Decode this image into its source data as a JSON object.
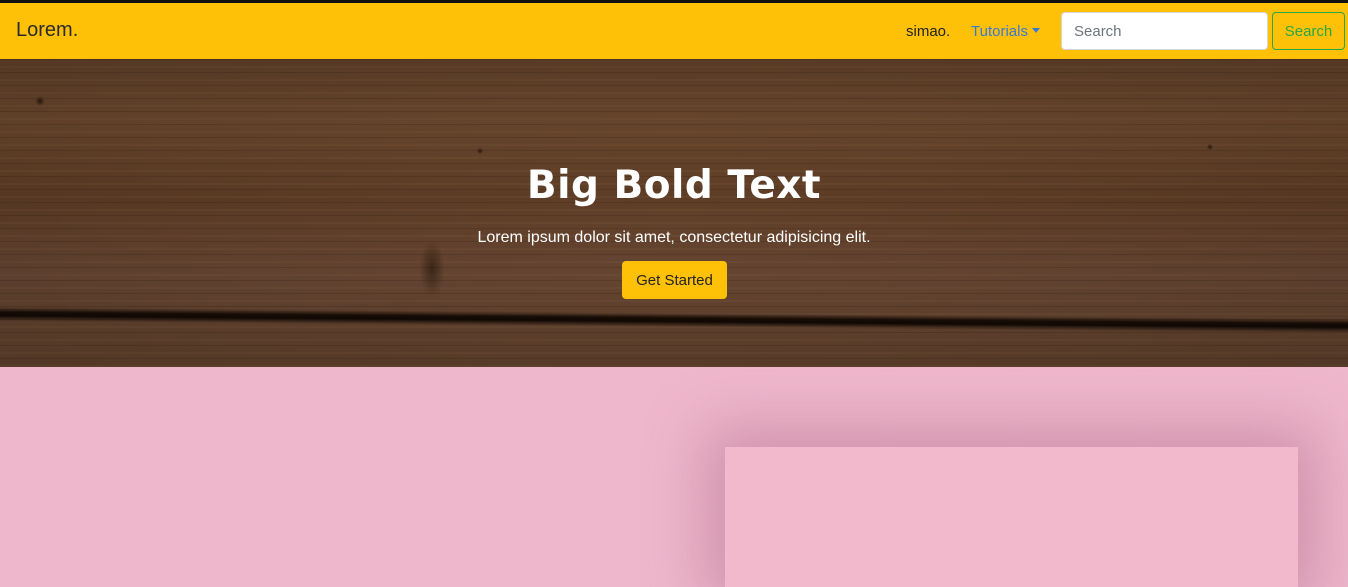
{
  "navbar": {
    "brand": "Lorem.",
    "link_simao": "simao.",
    "dropdown_label": "Tutorials",
    "search_placeholder": "Search",
    "search_button": "Search",
    "background_color": "#ffc107"
  },
  "hero": {
    "title": "Big Bold Text",
    "subtitle": "Lorem ipsum dolor sit amet, consectetur adipisicing elit.",
    "cta_label": "Get Started"
  },
  "colors": {
    "accent_yellow": "#ffc107",
    "search_green": "#28a745",
    "link_blue": "#3a78d6",
    "section_pink": "#efb7cc"
  }
}
